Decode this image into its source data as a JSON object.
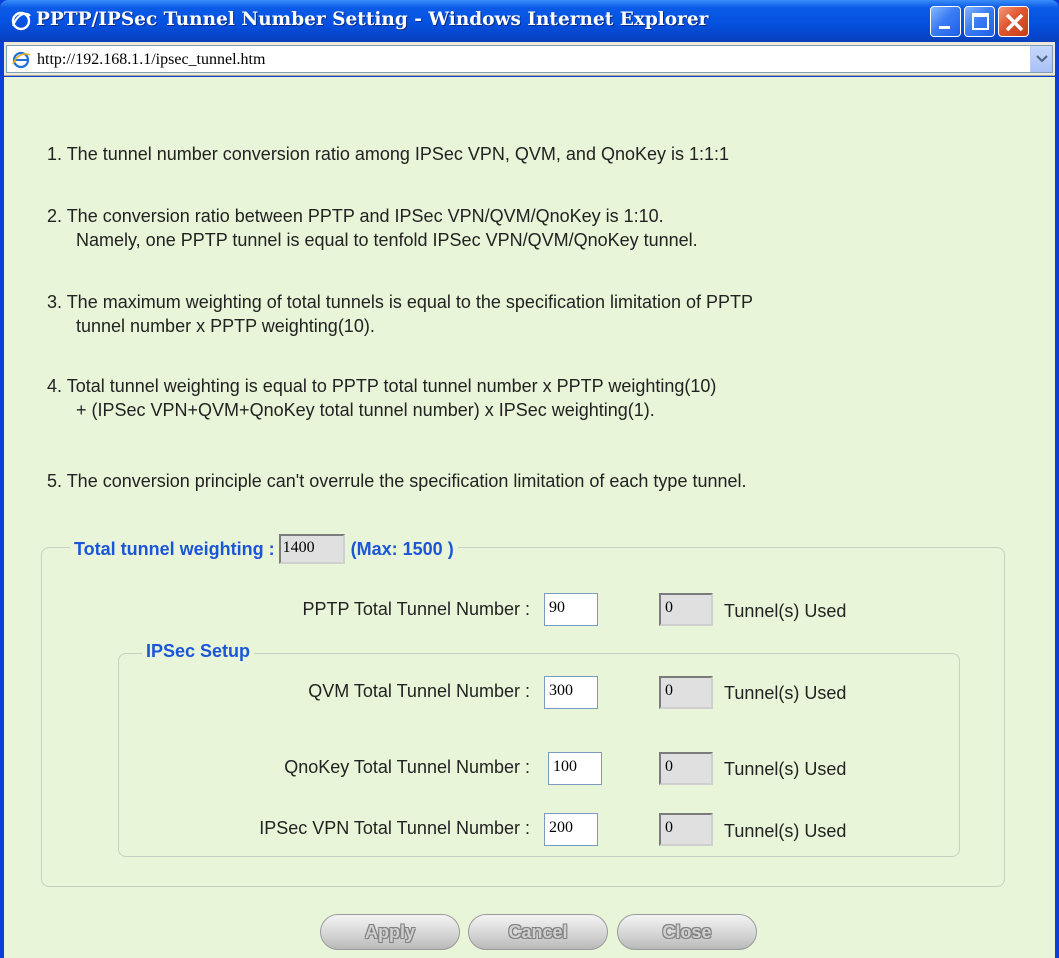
{
  "window": {
    "title": "PPTP/IPSec Tunnel Number Setting - Windows Internet Explorer",
    "address": "http://192.168.1.1/ipsec_tunnel.htm"
  },
  "notes": {
    "n1": "1. The tunnel number conversion ratio among IPSec VPN, QVM, and QnoKey is 1:1:1",
    "n2": "2. The conversion ratio between PPTP and IPSec VPN/QVM/QnoKey is 1:10.",
    "n2b": "Namely, one PPTP tunnel is equal to tenfold IPSec VPN/QVM/QnoKey tunnel.",
    "n3": "3. The maximum weighting of total tunnels is equal to the specification limitation of PPTP",
    "n3b": "tunnel number x PPTP weighting(10).",
    "n4": "4. Total tunnel weighting is equal to PPTP total tunnel number x PPTP weighting(10)",
    "n4b": "+ (IPSec VPN+QVM+QnoKey total tunnel number) x IPSec weighting(1).",
    "n5": "5. The conversion principle can't overrule the specification limitation of each type tunnel."
  },
  "total": {
    "label": "Total tunnel weighting :",
    "value": "1400",
    "max": "(Max: 1500 )"
  },
  "ipsec_legend": "IPSec Setup",
  "rows": [
    {
      "label": "PPTP Total Tunnel Number :",
      "value": "90",
      "used": "0",
      "used_label": "Tunnel(s) Used"
    },
    {
      "label": "QVM Total Tunnel Number :",
      "value": "300",
      "used": "0",
      "used_label": "Tunnel(s) Used"
    },
    {
      "label": "QnoKey Total Tunnel Number :",
      "value": "100",
      "used": "0",
      "used_label": "Tunnel(s) Used"
    },
    {
      "label": "IPSec VPN Total Tunnel Number :",
      "value": "200",
      "used": "0",
      "used_label": "Tunnel(s) Used"
    }
  ],
  "buttons": {
    "apply": "Apply",
    "cancel": "Cancel",
    "close": "Close"
  }
}
